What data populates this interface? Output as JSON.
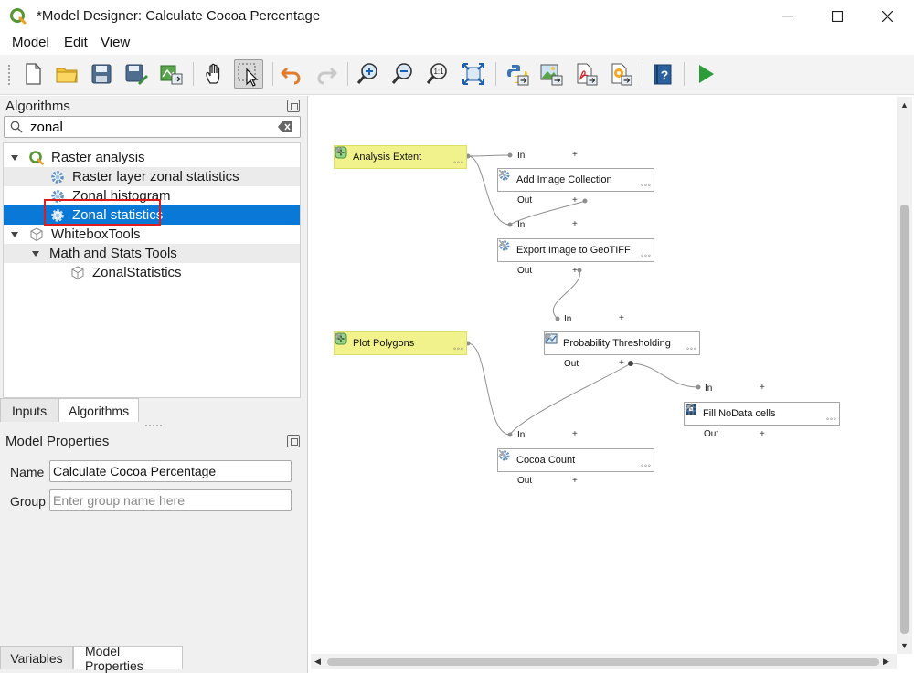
{
  "window": {
    "title": "*Model Designer: Calculate Cocoa Percentage",
    "minimize": "—",
    "maximize": "☐",
    "close": "✕"
  },
  "menu": [
    "Model",
    "Edit",
    "View"
  ],
  "toolbar": {
    "icons": [
      "new-model-icon",
      "open-model-icon",
      "save-model-icon",
      "save-as-icon",
      "export-to-project-icon",
      "pan-hand-icon",
      "select-icon",
      "undo-icon",
      "redo-icon",
      "zoom-in-icon",
      "zoom-out-icon",
      "zoom-actual-icon",
      "zoom-full-icon",
      "export-python-icon",
      "export-image-icon",
      "export-pdf-icon",
      "export-svg-icon",
      "help-icon",
      "run-icon"
    ]
  },
  "algorithms_panel": {
    "title": "Algorithms",
    "search_value": "zonal",
    "tree": [
      {
        "label": "Raster analysis",
        "level": 0,
        "expanded": true,
        "icon": "qgis-icon"
      },
      {
        "label": "Raster layer zonal statistics",
        "level": 1,
        "icon": "gear-icon"
      },
      {
        "label": "Zonal histogram",
        "level": 1,
        "icon": "gear-icon"
      },
      {
        "label": "Zonal statistics",
        "level": 1,
        "icon": "gear-icon",
        "selected": true
      },
      {
        "label": "WhiteboxTools",
        "level": 0,
        "expanded": true,
        "icon": "cube-icon"
      },
      {
        "label": "Math and Stats Tools",
        "level": 1,
        "expanded": true
      },
      {
        "label": "ZonalStatistics",
        "level": 2,
        "icon": "cube-icon"
      }
    ],
    "tabs": [
      "Inputs",
      "Algorithms"
    ],
    "active_tab": "Algorithms"
  },
  "model_properties": {
    "title": "Model Properties",
    "name_label": "Name",
    "name_value": "Calculate Cocoa Percentage",
    "group_label": "Group",
    "group_placeholder": "Enter group name here"
  },
  "bottom_tabs": [
    "Variables",
    "Model Properties"
  ],
  "bottom_active_tab": "Model Properties",
  "canvas": {
    "port_in": "In",
    "port_out": "Out",
    "nodes": [
      {
        "id": "analysis_extent",
        "label": "Analysis Extent",
        "type": "input"
      },
      {
        "id": "add_image_collection",
        "label": "Add Image Collection",
        "type": "algorithm",
        "icon": "gear-icon",
        "ports": [
          "In",
          "Out"
        ]
      },
      {
        "id": "export_geotiff",
        "label": "Export Image to GeoTIFF",
        "type": "algorithm",
        "icon": "gear-icon",
        "ports": [
          "In",
          "Out"
        ]
      },
      {
        "id": "plot_polygons",
        "label": "Plot Polygons",
        "type": "input"
      },
      {
        "id": "probability_thresholding",
        "label": "Probability Thresholding",
        "type": "algorithm",
        "icon": "model-icon",
        "ports": [
          "In",
          "Out"
        ]
      },
      {
        "id": "fill_nodata",
        "label": "Fill NoData cells",
        "type": "algorithm",
        "icon": "grid-icon",
        "ports": [
          "In",
          "Out"
        ]
      },
      {
        "id": "cocoa_count",
        "label": "Cocoa Count",
        "type": "algorithm",
        "icon": "gear-icon",
        "ports": [
          "In",
          "Out"
        ]
      }
    ]
  },
  "colors": {
    "selection": "#0a78d7",
    "highlight_box": "#e01b1b",
    "input_node": "#f2f28c",
    "run": "#2e9b3a"
  }
}
